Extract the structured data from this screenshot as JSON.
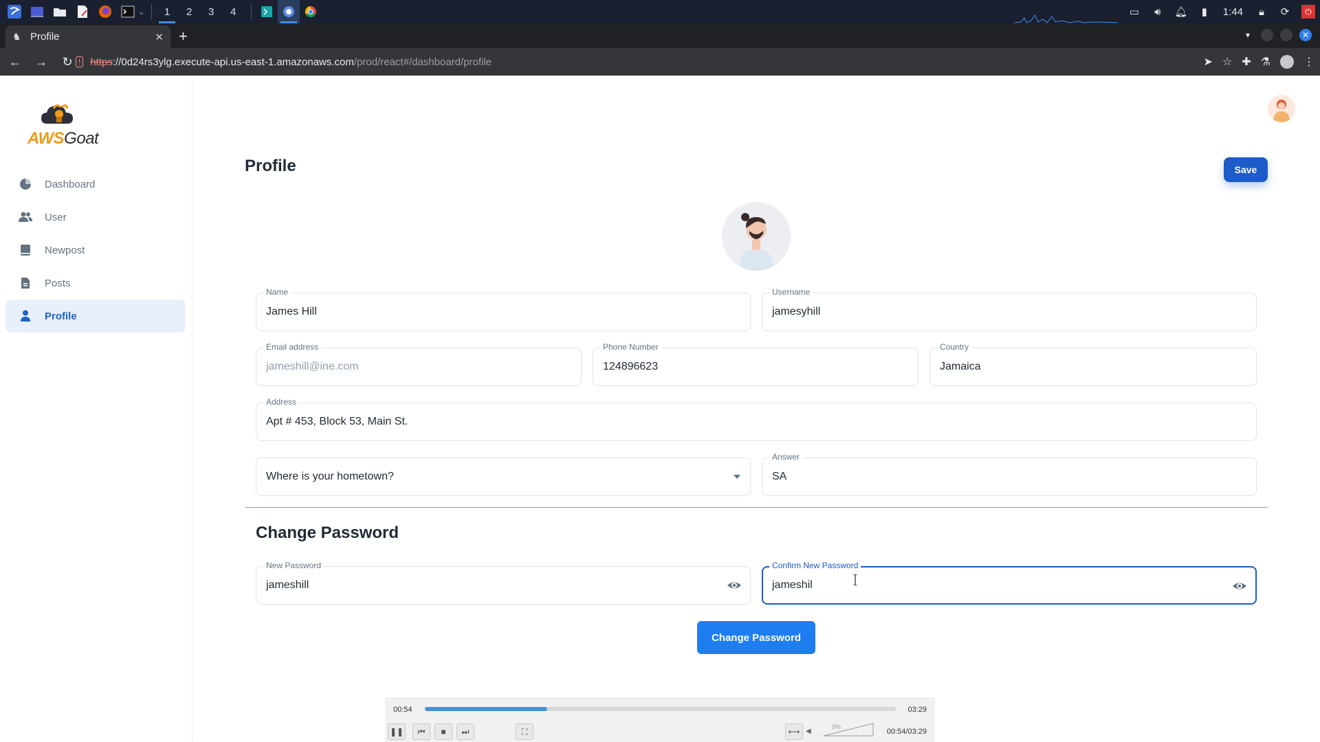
{
  "taskbar": {
    "workspaces": [
      "1",
      "2",
      "3",
      "4"
    ],
    "clock": "1:44"
  },
  "browser": {
    "tab_title": "Profile",
    "url_scheme": "https",
    "url_host": "://0d24rs3ylg.execute-api.us-east-1.amazonaws.com",
    "url_path": "/prod/react#/dashboard/profile"
  },
  "app": {
    "logo_part1": "AWS",
    "logo_part2": "Goat"
  },
  "sidebar": {
    "items": [
      {
        "label": "Dashboard"
      },
      {
        "label": "User"
      },
      {
        "label": "Newpost"
      },
      {
        "label": "Posts"
      },
      {
        "label": "Profile"
      }
    ]
  },
  "profile": {
    "title": "Profile",
    "save_label": "Save",
    "fields": {
      "name": {
        "label": "Name",
        "value": "James Hill"
      },
      "username": {
        "label": "Username",
        "value": "jamesyhill"
      },
      "email": {
        "label": "Email address",
        "value": "jameshill@ine.com"
      },
      "phone": {
        "label": "Phone Number",
        "value": "124896623"
      },
      "country": {
        "label": "Country",
        "value": "Jamaica"
      },
      "address": {
        "label": "Address",
        "value": "Apt # 453, Block 53, Main St."
      },
      "question": {
        "value": "Where is your hometown?"
      },
      "answer": {
        "label": "Answer",
        "value": "SA"
      }
    }
  },
  "change_password": {
    "title": "Change Password",
    "new_password": {
      "label": "New Password",
      "value": "jameshill"
    },
    "confirm_password": {
      "label": "Confirm New Password",
      "value": "jameshil"
    },
    "button_label": "Change Password"
  },
  "player": {
    "current": "00:54",
    "total": "03:29",
    "progress_fraction": 0.26,
    "volume": "0%",
    "combined": "00:54/03:29"
  },
  "colors": {
    "primary": "#1d5bc9",
    "accent_button": "#1e7ef0",
    "logo_orange": "#f29a1a",
    "nav_active_bg": "#e8f0fc"
  }
}
